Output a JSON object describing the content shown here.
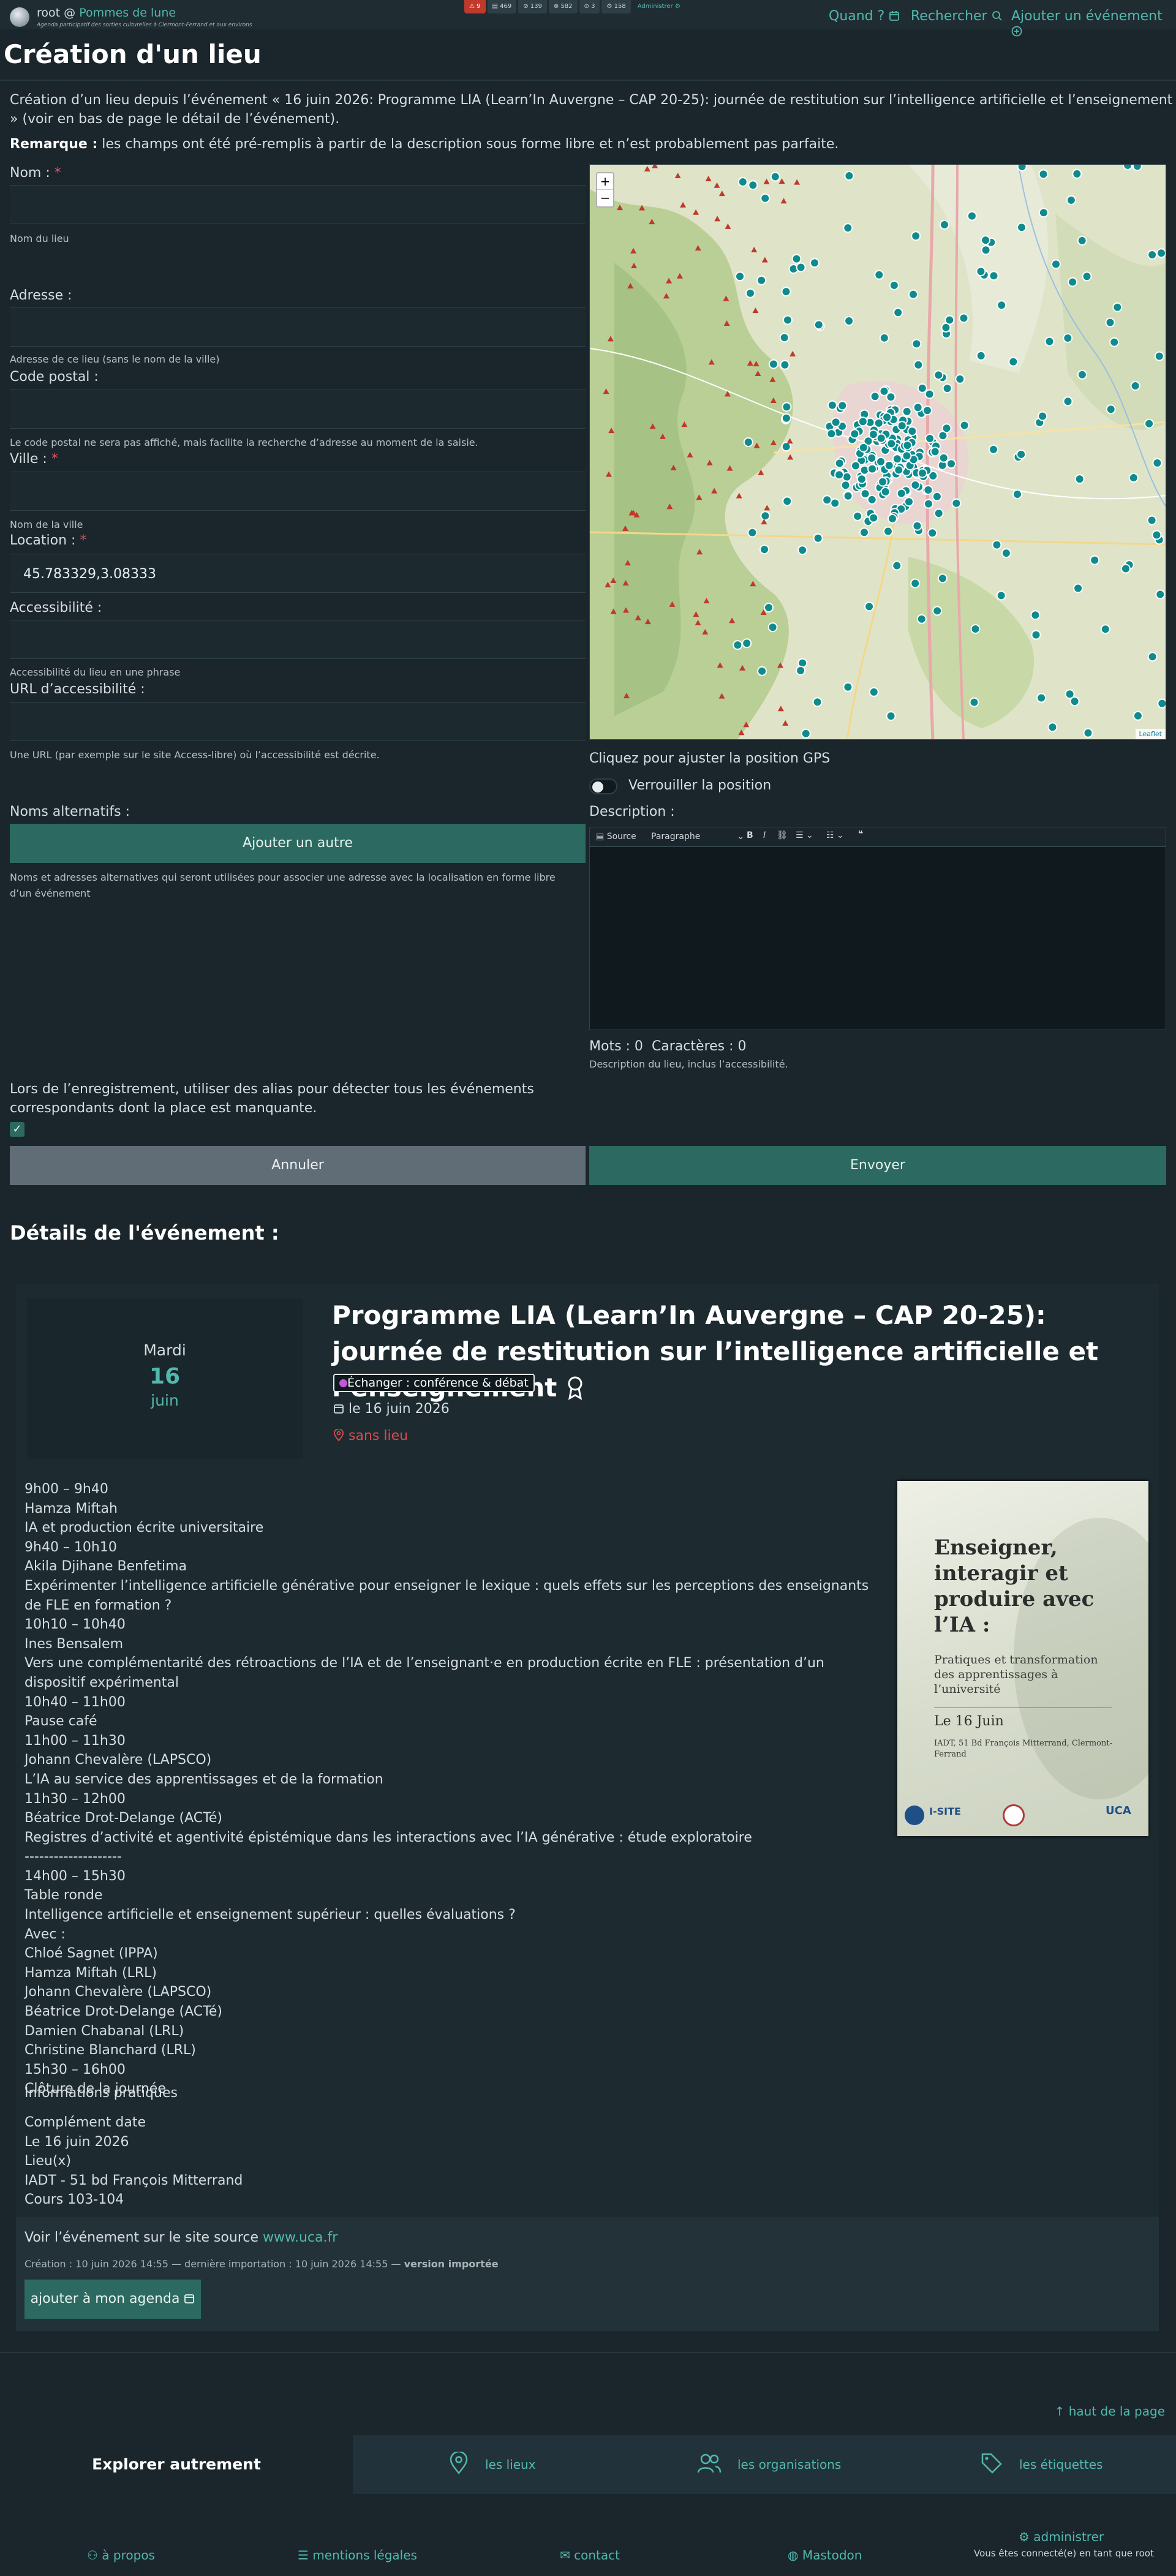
{
  "header": {
    "user": "root",
    "at": "@",
    "site": "Pommes de lune",
    "subtitle": "Agenda participatif des sorties culturelles à Clermont-Ferrand et aux environs",
    "stats": [
      "⚠ 9",
      "▤ 469",
      "⊘ 139",
      "⊕ 582",
      "⊙ 3",
      "⚙ 158"
    ],
    "admin": "Administrer ⚙",
    "nav": {
      "when": "Quand ?",
      "search": "Rechercher",
      "add": "Ajouter un événement"
    }
  },
  "page": {
    "title": "Création d'un lieu",
    "intro": "Création d’un lieu depuis l’événement « 16 juin 2026: Programme LIA (Learn’In Auvergne – CAP 20-25): journée de restitution sur l’intelligence artificielle et l’enseignement » (voir en bas de page le détail de l’événement).",
    "remark_label": "Remarque :",
    "remark_text": " les champs ont été pré-remplis à partir de la description sous forme libre et n’est probablement pas parfaite."
  },
  "form": {
    "name_label": "Nom :",
    "name_help": "Nom du lieu",
    "address_label": "Adresse :",
    "address_help": "Adresse de ce lieu (sans le nom de la ville)",
    "postal_label": "Code postal :",
    "postal_help": "Le code postal ne sera pas affiché, mais facilite la recherche d’adresse au moment de la saisie.",
    "city_label": "Ville :",
    "city_help": "Nom de la ville",
    "location_label": "Location :",
    "location_value": "45.783329,3.08333",
    "access_label": "Accessibilité :",
    "access_help": "Accessibilité du lieu en une phrase",
    "access_url_label": "URL d’accessibilité :",
    "access_url_help": "Une URL (par exemple sur le site Access-libre) où l’accessibilité est décrite.",
    "map_help": "Cliquez pour ajuster la position GPS",
    "lock_label": "Verrouiller la position",
    "alt_names_label": "Noms alternatifs :",
    "add_other": "Ajouter un autre",
    "alt_names_help": "Noms et adresses alternatives qui seront utilisées pour associer une adresse avec la localisation en forme libre d’un événement",
    "description_label": "Description :",
    "editor_source": "Source",
    "editor_paragraph": "Paragraphe",
    "words": "Mots : 0",
    "chars": "Caractères : 0",
    "description_help": "Description du lieu, inclus l’accessibilité.",
    "alias_text": "Lors de l’enregistrement, utiliser des alias pour détecter tous les événements correspondants dont la place est manquante.",
    "cancel": "Annuler",
    "submit": "Envoyer"
  },
  "map": {
    "zoom_in": "+",
    "zoom_out": "−",
    "attribution": "Leaflet"
  },
  "event": {
    "section_title": "Détails de l'événement :",
    "weekday": "Mardi",
    "day": "16",
    "month": "juin",
    "title": "Programme LIA (Learn’In Auvergne – CAP 20-25): journée de restitution sur l’intelligence artificielle et l’enseignement",
    "tag": "Échanger : conférence & débat",
    "date": "le 16 juin 2026",
    "no_place": "sans lieu",
    "program": [
      "9h00 – 9h40",
      "Hamza Miftah",
      "IA et production écrite universitaire",
      "9h40 – 10h10",
      "Akila Djihane Benfetima",
      "Expérimenter l’intelligence artificielle générative pour enseigner le lexique : quels effets sur les perceptions des enseignants de FLE en formation ?",
      "10h10 – 10h40",
      "Ines Bensalem",
      "Vers une complémentarité des rétroactions de l’IA et de l’enseignant·e en production écrite en FLE : présentation d’un dispositif expérimental",
      "10h40 – 11h00",
      "Pause café",
      "11h00 – 11h30",
      "Johann Chevalère (LAPSCO)",
      "L’IA au service des apprentissages et de la formation",
      "11h30 – 12h00",
      "Béatrice Drot-Delange (ACTé)",
      "Registres d’activité et agentivité épistémique dans les interactions avec l’IA générative : étude exploratoire",
      "--------------------",
      "14h00 – 15h30",
      "Table ronde",
      "Intelligence artificielle et enseignement supérieur : quelles évaluations ?",
      "Avec :",
      "Chloé Sagnet (IPPA)",
      "Hamza Miftah (LRL)",
      "Johann Chevalère (LAPSCO)",
      "Béatrice Drot-Delange (ACTé)",
      "Damien Chabanal (LRL)",
      "Christine Blanchard (LRL)",
      "15h30 – 16h00",
      "Clôture de la journée"
    ],
    "practical_title": "Informations pratiques",
    "practical": [
      "Complément date",
      "Le 16 juin 2026",
      "Lieu(x)",
      "IADT - 51 bd François Mitterrand",
      "Cours 103-104"
    ],
    "poster": {
      "title": "Enseigner, interagir et produire avec l’IA :",
      "subtitle": "Pratiques et transformation des apprentissages à l’université",
      "date": "Le 16 Juin",
      "place": "IADT, 51 Bd François Mitterrand, Clermont-Ferrand",
      "isite": "I-SITE",
      "uca": "UCA"
    },
    "source_text": "Voir l’événement sur le site source ",
    "source_link": "www.uca.fr",
    "meta": "Création : 10 juin 2026 14:55 — dernière importation : 10 juin 2026 14:55 — ",
    "meta_bold": "version importée",
    "add_agenda": "ajouter à mon agenda"
  },
  "bottom": {
    "back_top": "↑ haut de la page",
    "explore": "Explorer autrement",
    "places": "les lieux",
    "orgs": "les organisations",
    "tags": "les étiquettes"
  },
  "footer": {
    "about": "à propos",
    "legal": "mentions légales",
    "contact": "contact",
    "mastodon": "Mastodon",
    "admin": "administrer",
    "connected": "Vous êtes connecté(e) en tant que root"
  }
}
